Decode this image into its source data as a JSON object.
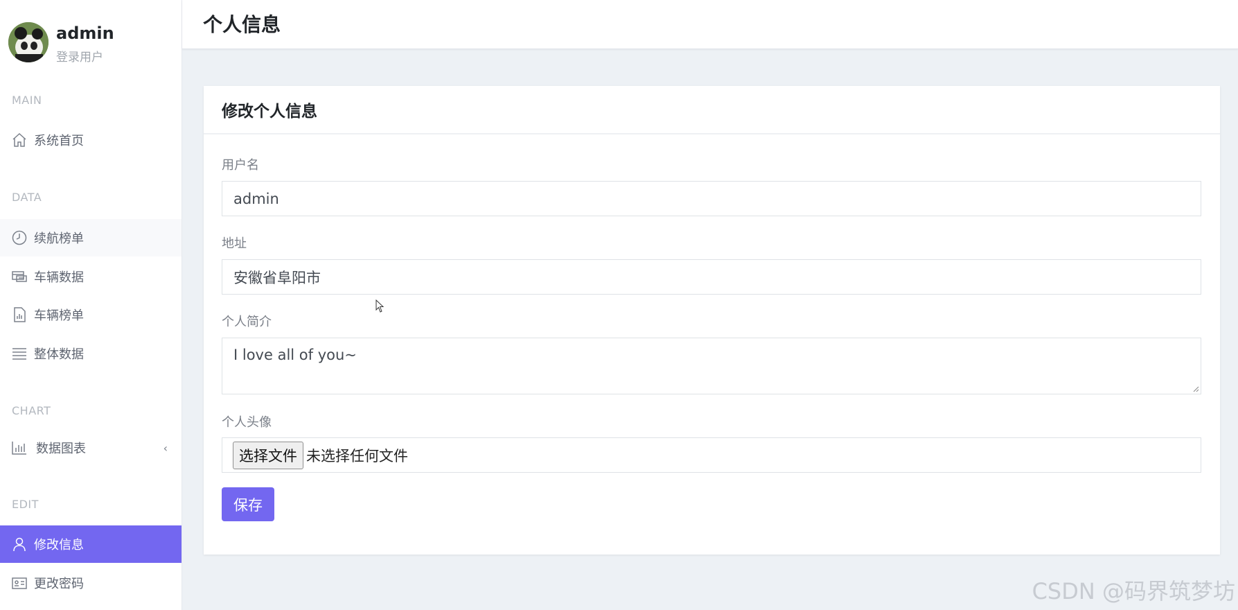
{
  "profile": {
    "username": "admin",
    "role": "登录用户"
  },
  "sidebar": {
    "sections": [
      {
        "label": "MAIN"
      },
      {
        "label": "DATA"
      },
      {
        "label": "CHART"
      },
      {
        "label": "EDIT"
      }
    ],
    "items": [
      {
        "label": "系统首页",
        "icon": "home-icon"
      },
      {
        "label": "续航榜单",
        "icon": "clock-icon"
      },
      {
        "label": "车辆数据",
        "icon": "vehicle-icon"
      },
      {
        "label": "车辆榜单",
        "icon": "document-chart-icon"
      },
      {
        "label": "整体数据",
        "icon": "list-icon"
      },
      {
        "label": "数据图表",
        "icon": "bar-chart-icon"
      },
      {
        "label": "修改信息",
        "icon": "user-icon"
      },
      {
        "label": "更改密码",
        "icon": "id-card-icon"
      }
    ],
    "chevron": "‹"
  },
  "header": {
    "title": "个人信息"
  },
  "card": {
    "title": "修改个人信息",
    "fields": {
      "username": {
        "label": "用户名",
        "value": "admin"
      },
      "address": {
        "label": "地址",
        "value": "安徽省阜阳市"
      },
      "bio": {
        "label": "个人简介",
        "value": "I love all of you~"
      },
      "avatar": {
        "label": "个人头像",
        "button": "选择文件",
        "status": "未选择任何文件"
      }
    },
    "save_label": "保存"
  },
  "watermark": "CSDN @码界筑梦坊",
  "colors": {
    "accent": "#7367f0",
    "background": "#edf1f5"
  }
}
